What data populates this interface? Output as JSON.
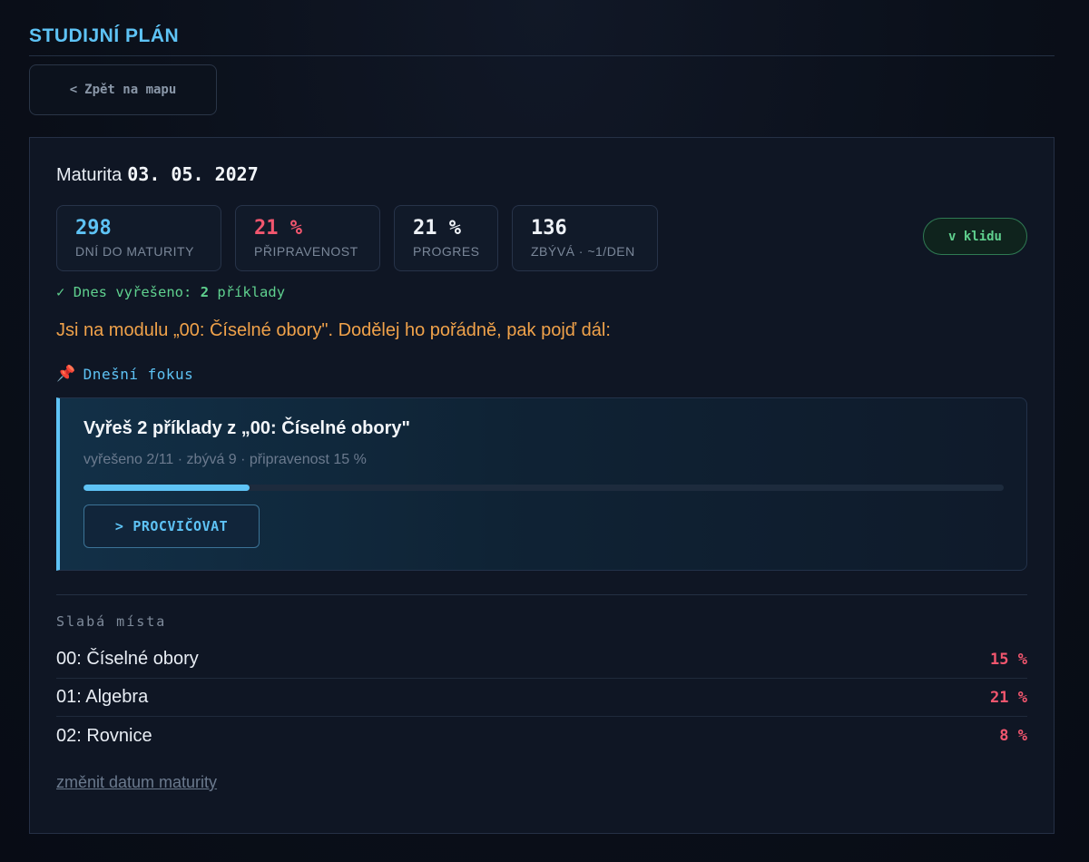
{
  "header": {
    "title": "STUDIJNÍ PLÁN"
  },
  "back_button": {
    "chevron": "<",
    "label": "Zpět na mapu"
  },
  "exam": {
    "label": "Maturita",
    "date": "03. 05. 2027"
  },
  "stats": [
    {
      "value": "298",
      "label": "DNÍ DO MATURITY",
      "color": "#5ec3f5"
    },
    {
      "value": "21 %",
      "label": "PŘIPRAVENOST",
      "color": "#f2566e"
    },
    {
      "value": "21 %",
      "label": "PROGRES",
      "color": "#eef2f7"
    },
    {
      "value": "136",
      "label": "ZBÝVÁ · ~1/DEN",
      "color": "#eef2f7"
    }
  ],
  "status_badge": "v klidu",
  "today": {
    "check": "✓",
    "prefix": "Dnes vyřešeno:",
    "count": "2",
    "suffix": "příklady"
  },
  "module_message": "Jsi na modulu „00: Číselné obory\". Dodělej ho pořádně, pak pojď dál:",
  "focus": {
    "icon": "pushpin-icon",
    "title": "Dnešní fokus",
    "task": "Vyřeš 2 příklady z „00: Číselné obory\"",
    "meta": "vyřešeno 2/11 · zbývá 9 · připravenost 15 %",
    "progress": 0.18,
    "button_chevron": ">",
    "button_label": "PROCVIČOVAT"
  },
  "weak_spots": {
    "title": "Slabá místa",
    "items": [
      {
        "name": "00: Číselné obory",
        "pct": "15 %"
      },
      {
        "name": "01: Algebra",
        "pct": "21 %"
      },
      {
        "name": "02: Rovnice",
        "pct": "8 %"
      }
    ]
  },
  "change_date_link": "změnit datum maturity"
}
